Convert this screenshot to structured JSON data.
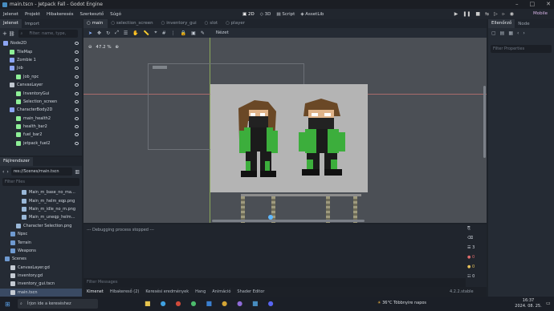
{
  "window": {
    "title": "main.tscn - Jetpack Fall - Godot Engine"
  },
  "menu": [
    "Jelenet",
    "Projekt",
    "Hibakeresés",
    "Szerkesztő",
    "Súgó"
  ],
  "workspaces": {
    "2d": "2D",
    "3d": "3D",
    "script": "Script",
    "assetlib": "AssetLib"
  },
  "renderer": "Mobile",
  "scene_dock": {
    "tabs": [
      "Jelenet",
      "Import"
    ],
    "filter_placeholder": "Filter: name, type,",
    "nodes": [
      {
        "label": "Node2D",
        "indent": 0,
        "color": "#8da5f3"
      },
      {
        "label": "TileMap",
        "indent": 1,
        "color": "#8eef97"
      },
      {
        "label": "Zombie 1",
        "indent": 1,
        "color": "#8da5f3"
      },
      {
        "label": "Job",
        "indent": 1,
        "color": "#8da5f3"
      },
      {
        "label": "Job_npc",
        "indent": 2,
        "color": "#8eef97"
      },
      {
        "label": "CanvasLayer",
        "indent": 1,
        "color": "#c0c7d0"
      },
      {
        "label": "InventoryGui",
        "indent": 2,
        "color": "#8eef97"
      },
      {
        "label": "Selection_screen",
        "indent": 2,
        "color": "#8eef97"
      },
      {
        "label": "CharacterBody2D",
        "indent": 1,
        "color": "#8da5f3"
      },
      {
        "label": "main_health2",
        "indent": 2,
        "color": "#8eef97"
      },
      {
        "label": "health_bar2",
        "indent": 2,
        "color": "#8eef97"
      },
      {
        "label": "fuel_bar2",
        "indent": 2,
        "color": "#8eef97"
      },
      {
        "label": "jetpack_fuel2",
        "indent": 2,
        "color": "#8eef97"
      }
    ]
  },
  "filesystem_dock": {
    "title": "Fájlrendszer",
    "path": "res://Scenes/main.tscn",
    "filter_placeholder": "Filter Files",
    "files": [
      {
        "label": "Main_m_base_no_ma…",
        "indent": 3
      },
      {
        "label": "Main_m_helm_eqp.png",
        "indent": 3
      },
      {
        "label": "Main_m_idle_no_m.png",
        "indent": 3
      },
      {
        "label": "Main_m_uneqp_helm…",
        "indent": 3
      },
      {
        "label": "Character Selection.png",
        "indent": 2
      },
      {
        "label": "Npsc",
        "indent": 1
      },
      {
        "label": "Terrain",
        "indent": 1
      },
      {
        "label": "Weapons",
        "indent": 1
      },
      {
        "label": "Scenes",
        "indent": 0
      },
      {
        "label": "CanvasLayer.gd",
        "indent": 1
      },
      {
        "label": "inventory.gd",
        "indent": 1
      },
      {
        "label": "inventory_gui.tscn",
        "indent": 1
      },
      {
        "label": "main.tscn",
        "indent": 1
      }
    ]
  },
  "editor_tabs": [
    "main",
    "selection_screen",
    "inventory_gui",
    "slot",
    "player"
  ],
  "viewport": {
    "zoom": "47.2 %",
    "view_menu": "Nézet"
  },
  "output": {
    "message": "--- Debugging process stopped ---",
    "filter_placeholder": "Filter Messages",
    "counts": {
      "log": "3",
      "errors": "0",
      "warnings": "0",
      "messages": "0"
    }
  },
  "bottom_tabs": [
    "Kimenet",
    "Hibakereső (2)",
    "Keresési eredmények",
    "Hang",
    "Animáció",
    "Shader Editor"
  ],
  "version": "4.2.2.stable",
  "inspector": {
    "tabs": [
      "Ellenőrző",
      "Node"
    ],
    "filter_placeholder": "Filter Properties"
  },
  "taskbar": {
    "search_placeholder": "Írjon ide a kereséshez",
    "weather": "36°C  Többnyire napos",
    "time": "16:37",
    "date": "2024. 08. 25."
  }
}
